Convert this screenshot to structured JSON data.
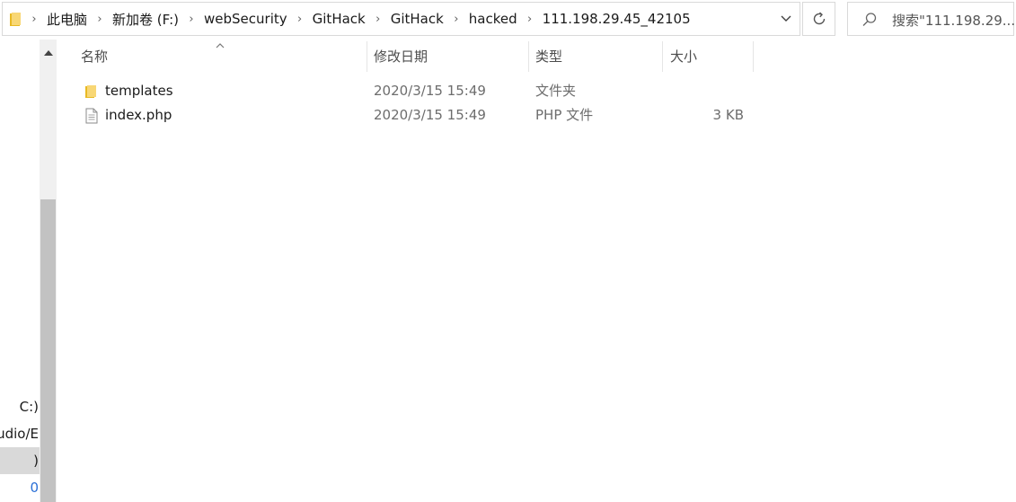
{
  "address_bar": {
    "breadcrumbs": [
      "此电脑",
      "新加卷 (F:)",
      "webSecurity",
      "GitHack",
      "GitHack",
      "hacked",
      "111.198.29.45_42105"
    ]
  },
  "search": {
    "placeholder": "搜索\"111.198.29...."
  },
  "columns": {
    "name": "名称",
    "date": "修改日期",
    "type": "类型",
    "size": "大小"
  },
  "files": [
    {
      "name": "templates",
      "date": "2020/3/15 15:49",
      "type": "文件夹",
      "size": "",
      "icon": "folder-icon"
    },
    {
      "name": "index.php",
      "date": "2020/3/15 15:49",
      "type": "PHP 文件",
      "size": "3 KB",
      "icon": "file-icon"
    }
  ],
  "nav_pane": {
    "items": [
      "C:)",
      "udio/E",
      ")",
      "0"
    ]
  },
  "colors": {
    "folder": "#f4c842",
    "selected_row": "#d9d9d9",
    "border": "#d9d9d9"
  }
}
